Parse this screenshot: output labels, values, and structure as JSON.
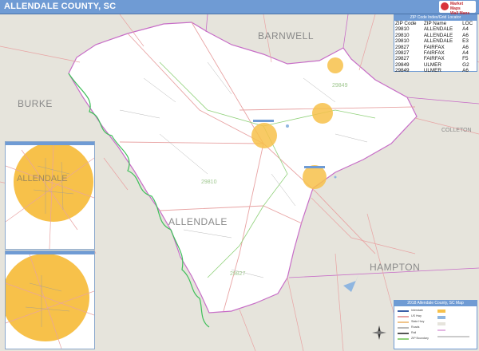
{
  "title": "ALLENDALE COUNTY, SC",
  "logo": {
    "line1": "Market",
    "line2": "Maps",
    "line3": "Wall Maps"
  },
  "labels": {
    "burke": "BURKE",
    "barnwell": "BARNWELL",
    "allendale_county": "ALLENDALE",
    "hampton": "HAMPTON",
    "colleton": "COLLETON",
    "inset_top": "ALLENDALE",
    "zip_29849": "29849",
    "zip_29810": "29810",
    "zip_29827": "29827"
  },
  "zip_index": {
    "heading": "ZIP Code Index/Grid Locator",
    "columns": [
      "ZIP Code",
      "ZIP Name",
      "LOC"
    ],
    "rows": [
      [
        "29810",
        "ALLENDALE",
        "A4"
      ],
      [
        "29810",
        "ALLENDALE",
        "A6"
      ],
      [
        "29810",
        "ALLENDALE",
        "E3"
      ],
      [
        "29827",
        "FAIRFAX",
        "A6"
      ],
      [
        "29827",
        "FAIRFAX",
        "A4"
      ],
      [
        "29827",
        "FAIRFAX",
        "F5"
      ],
      [
        "29849",
        "ULMER",
        "G2"
      ],
      [
        "29849",
        "ULMER",
        "A6"
      ]
    ]
  },
  "legend": {
    "heading": "2018 Allendale County, SC Map",
    "items": [
      "Interstate",
      "US Hwy",
      "State Hwy",
      "Roads",
      "Rail",
      "ZIP Boundary"
    ]
  },
  "colors": {
    "title_bar": "#6f9bd4",
    "county_fill": "#ffffff",
    "outside_fill": "#e6e4dc",
    "city_fill": "#f7c14a",
    "us_road": "#e8a3a3",
    "zip_boundary": "#90d17a",
    "water": "#8fb6e0"
  }
}
